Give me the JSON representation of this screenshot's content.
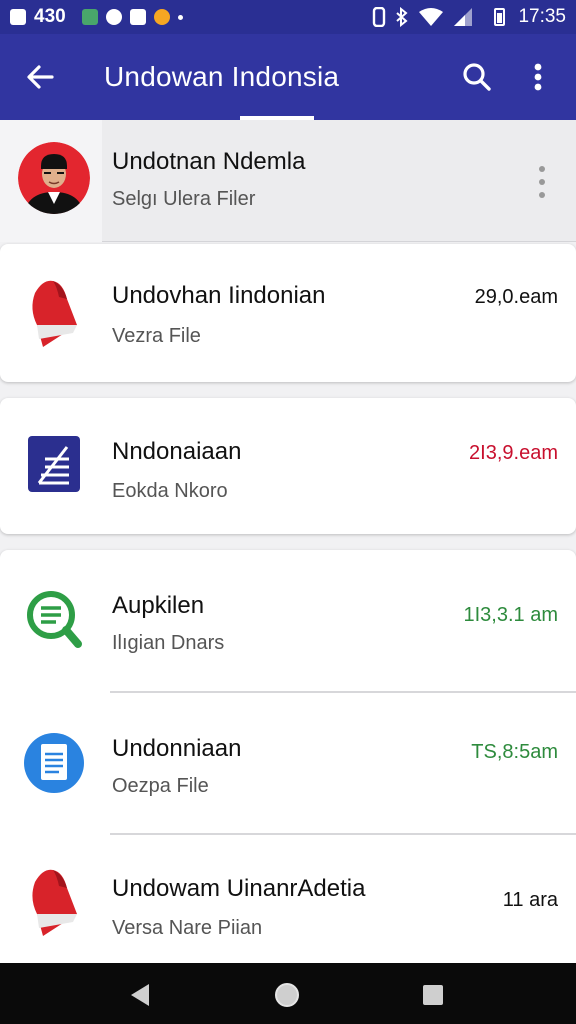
{
  "status_bar": {
    "left_text": "430",
    "time": "17:35"
  },
  "app_bar": {
    "title": "Undowan Indonsia"
  },
  "contact": {
    "name": "Undotnan Ndemla",
    "subtitle": "Selgı Ulera Filer"
  },
  "items": [
    {
      "title": "Undovhan Iindonian",
      "subtitle": "Vezra File",
      "time": "29,0.eam",
      "time_color": "#111111",
      "icon": "red-flag-icon"
    },
    {
      "title": "Nndonaiaan",
      "subtitle": "Eokda Nkoro",
      "time": "2I3,9.eam",
      "time_color": "#c8102e",
      "icon": "document-lines-icon"
    },
    {
      "title": "Aupkilen",
      "subtitle": "Ilıgian Dnars",
      "time": "1I3,3.1 am",
      "time_color": "#2e8b3d",
      "icon": "green-search-doc-icon"
    },
    {
      "title": "Undonniaan",
      "subtitle": "Oezpa File",
      "time": "TS,8:5am",
      "time_color": "#2e8b3d",
      "icon": "blue-document-icon"
    },
    {
      "title": "Undowam UinanrAdetia",
      "subtitle": "Versa Nare Piian",
      "time": "11 ara",
      "time_color": "#111111",
      "icon": "red-flag-icon"
    }
  ],
  "colors": {
    "primary": "#3135a0",
    "status": "#2a2f93",
    "green": "#2e8b3d",
    "red": "#c8102e"
  }
}
